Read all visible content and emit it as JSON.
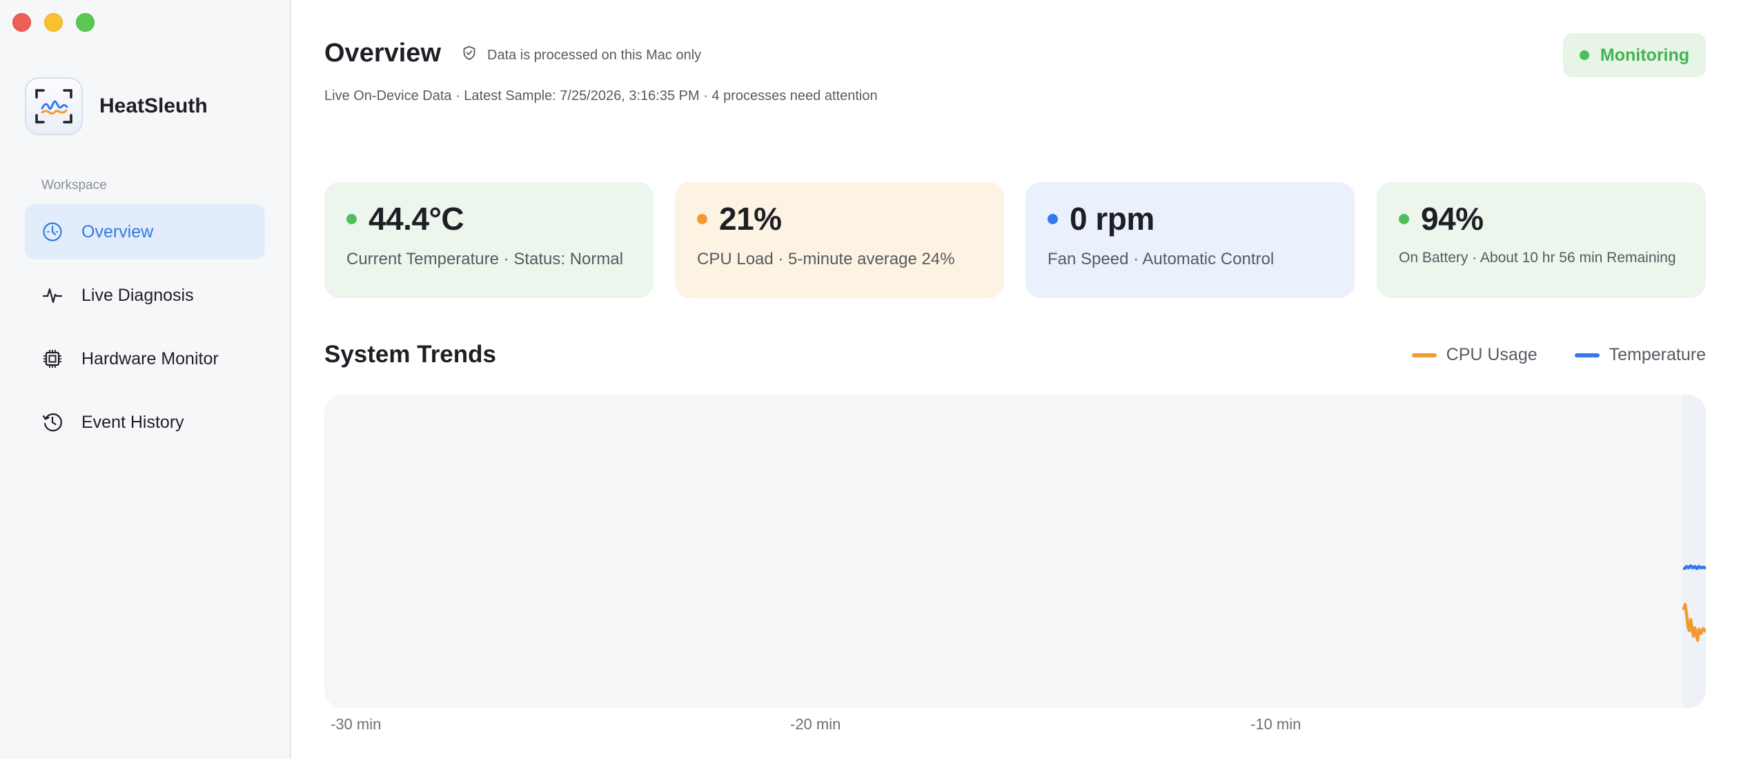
{
  "app": {
    "name": "HeatSleuth"
  },
  "sidebar": {
    "section_label": "Workspace",
    "items": [
      {
        "label": "Overview",
        "icon": "gauge-icon",
        "active": true
      },
      {
        "label": "Live Diagnosis",
        "icon": "waveform-icon",
        "active": false
      },
      {
        "label": "Hardware Monitor",
        "icon": "chip-icon",
        "active": false
      },
      {
        "label": "Event History",
        "icon": "history-icon",
        "active": false
      }
    ]
  },
  "header": {
    "title": "Overview",
    "privacy_text": "Data is processed on this Mac only",
    "subtitle": "Live On-Device Data · Latest Sample: 7/25/2026, 3:16:35 PM · 4 processes need attention",
    "status_label": "Monitoring"
  },
  "cards": [
    {
      "value": "44.4°C",
      "caption": "Current Temperature · Status: Normal",
      "dot_color": "#4fbf5a"
    },
    {
      "value": "21%",
      "caption": "CPU Load · 5-minute average 24%",
      "dot_color": "#f29a32"
    },
    {
      "value": "0 rpm",
      "caption": "Fan Speed · Automatic Control",
      "dot_color": "#3478f0"
    },
    {
      "value": "94%",
      "caption": "On Battery · About 10 hr 56 min Remaining",
      "dot_color": "#4fbf5a"
    }
  ],
  "trends": {
    "title": "System Trends",
    "legend": [
      {
        "label": "CPU Usage",
        "color": "#f29a32"
      },
      {
        "label": "Temperature",
        "color": "#3478f0"
      }
    ],
    "x_ticks": [
      "-30 min",
      "-20 min",
      "-10 min"
    ]
  },
  "colors": {
    "accent": "#2f7ce0",
    "status_green": "#4fbf5a",
    "cpu_orange": "#f29a32",
    "temp_blue": "#3478f0"
  }
}
